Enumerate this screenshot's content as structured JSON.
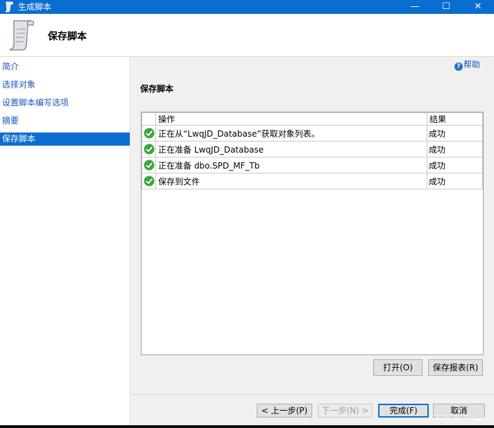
{
  "window": {
    "title": "生成脚本",
    "controls": {
      "minimize": "—",
      "maximize": "☐",
      "close": "✕"
    }
  },
  "header": {
    "title": "保存脚本",
    "icon": "script-scroll-icon"
  },
  "sidebar": {
    "items": [
      {
        "label": "简介",
        "selected": false
      },
      {
        "label": "选择对象",
        "selected": false
      },
      {
        "label": "设置脚本编写选项",
        "selected": false
      },
      {
        "label": "摘要",
        "selected": false
      },
      {
        "label": "保存脚本",
        "selected": true
      }
    ]
  },
  "main": {
    "help_label": "帮助",
    "section_title": "保存脚本",
    "table": {
      "columns": [
        "操作",
        "结果"
      ],
      "rows": [
        {
          "action": "正在从“LwqJD_Database”获取对象列表。",
          "result": "成功",
          "status_icon": "success-check-icon"
        },
        {
          "action": "正在准备 LwqJD_Database",
          "result": "成功",
          "status_icon": "success-check-icon"
        },
        {
          "action": "正在准备 dbo.SPD_MF_Tb",
          "result": "成功",
          "status_icon": "success-check-icon"
        },
        {
          "action": "保存到文件",
          "result": "成功",
          "status_icon": "success-check-icon"
        }
      ]
    },
    "open_button": "打开(O)",
    "save_report_button": "保存报表(R)"
  },
  "footer": {
    "prev_button": "< 上一步(P)",
    "next_button": "下一步(N) >",
    "finish_button": "完成(F)",
    "cancel_button": "取消"
  },
  "watermark": "CSDN @Ching~",
  "colors": {
    "accent": "#0a6ed1",
    "link": "#1a56b8",
    "success": "#3aa83a"
  }
}
